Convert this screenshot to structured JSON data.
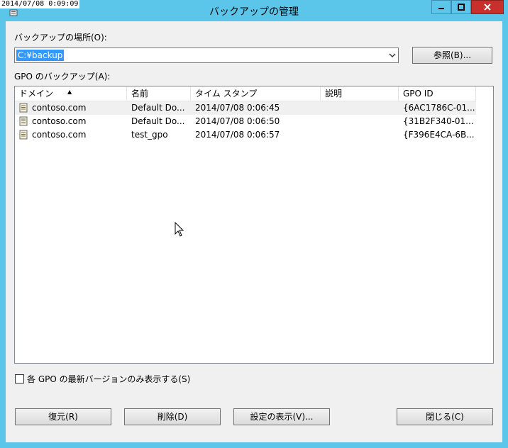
{
  "window": {
    "title": "バックアップの管理",
    "timestamp_overlay": "2014/07/08 0:09:09"
  },
  "location": {
    "label": "バックアップの場所(O):",
    "value": "C:¥backup",
    "browse_button": "参照(B)..."
  },
  "list": {
    "label": "GPO のバックアップ(A):",
    "columns": [
      "ドメイン",
      "名前",
      "タイム スタンプ",
      "説明",
      "GPO ID"
    ],
    "sort_column": "ドメイン",
    "rows": [
      {
        "domain": "contoso.com",
        "name": "Default Do...",
        "timestamp": "2014/07/08 0:06:45",
        "description": "",
        "gpo_id": "{6AC1786C-01..."
      },
      {
        "domain": "contoso.com",
        "name": "Default Do...",
        "timestamp": "2014/07/08 0:06:50",
        "description": "",
        "gpo_id": "{31B2F340-01..."
      },
      {
        "domain": "contoso.com",
        "name": "test_gpo",
        "timestamp": "2014/07/08 0:06:57",
        "description": "",
        "gpo_id": "{F396E4CA-6B..."
      }
    ]
  },
  "checkbox": {
    "label": "各 GPO の最新バージョンのみ表示する(S)",
    "checked": false
  },
  "buttons": {
    "restore": "復元(R)",
    "delete": "削除(D)",
    "view_settings": "設定の表示(V)...",
    "close": "閉じる(C)"
  },
  "colors": {
    "frame": "#5cc6ea",
    "close_button": "#c7302b",
    "selection": "#3399ff"
  }
}
